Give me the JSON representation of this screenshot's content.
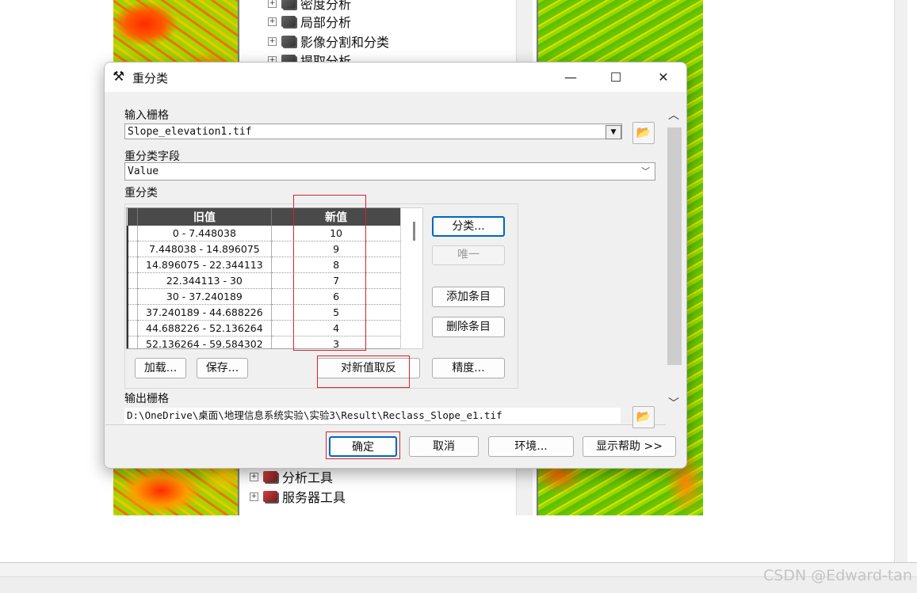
{
  "background": {
    "tree_items_top": [
      {
        "label": "密度分析",
        "icon": "toolbox-icon"
      },
      {
        "label": "局部分析",
        "icon": "toolbox-icon"
      },
      {
        "label": "影像分割和分类",
        "icon": "toolbox-icon"
      },
      {
        "label": "提取分析",
        "icon": "toolbox-icon"
      }
    ],
    "tree_items_bottom": [
      {
        "label": "分析工具",
        "icon": "toolbox-icon"
      },
      {
        "label": "服务器工具",
        "icon": "toolbox-icon"
      }
    ],
    "watermark": "CSDN @Edward-tan"
  },
  "dialog": {
    "title": "重分类",
    "title_icon": "hammer-icon",
    "controls": {
      "minimize": "—",
      "maximize": "☐",
      "close": "✕"
    },
    "input_raster": {
      "label": "输入栅格",
      "value": "Slope_elevation1.tif"
    },
    "reclass_field": {
      "label": "重分类字段",
      "value": "Value"
    },
    "reclass": {
      "label": "重分类",
      "columns": [
        "旧值",
        "新值"
      ],
      "rows": [
        {
          "old": "0 - 7.448038",
          "new": "10"
        },
        {
          "old": "7.448038 - 14.896075",
          "new": "9"
        },
        {
          "old": "14.896075 - 22.344113",
          "new": "8"
        },
        {
          "old": "22.344113 - 30",
          "new": "7"
        },
        {
          "old": "30 - 37.240189",
          "new": "6"
        },
        {
          "old": "37.240189 - 44.688226",
          "new": "5"
        },
        {
          "old": "44.688226 - 52.136264",
          "new": "4"
        },
        {
          "old": "52.136264 - 59.584302",
          "new": "3"
        }
      ],
      "buttons": {
        "classify": "分类...",
        "unique": "唯一",
        "add_entry": "添加条目",
        "delete_entry": "删除条目",
        "load": "加载...",
        "save": "保存...",
        "reverse": "对新值取反",
        "precision": "精度..."
      }
    },
    "output_raster": {
      "label": "输出栅格",
      "value": "D:\\OneDrive\\桌面\\地理信息系统实验\\实验3\\Result\\Reclass_Slope_e1.tif"
    },
    "footer": {
      "ok": "确定",
      "cancel": "取消",
      "env": "环境...",
      "help": "显示帮助 >>"
    }
  }
}
